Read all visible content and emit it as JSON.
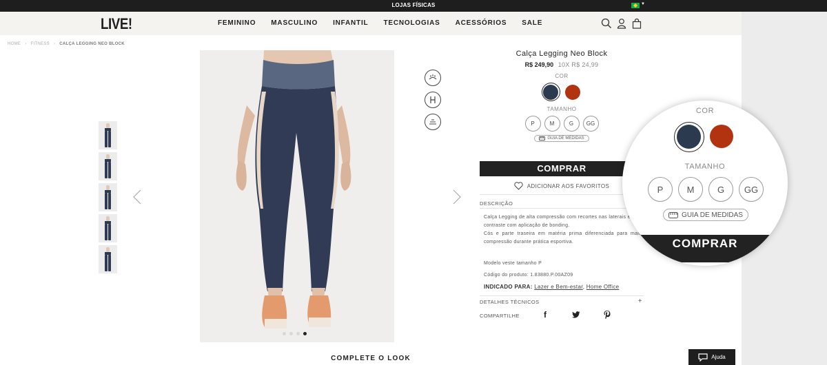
{
  "topbar": {
    "label": "LOJAS FÍSICAS"
  },
  "header": {
    "logo": "LIVE!",
    "nav": [
      "FEMININO",
      "MASCULINO",
      "INFANTIL",
      "TECNOLOGIAS",
      "ACESSÓRIOS",
      "SALE"
    ],
    "icons": [
      "search-icon",
      "user-icon",
      "bag-icon"
    ]
  },
  "breadcrumb": {
    "home": "HOME",
    "category": "FITNESS",
    "current": "CALÇA LEGGING NEO BLOCK"
  },
  "product": {
    "title": "Calça Legging Neo Block",
    "price": "R$ 249,90",
    "installments": "10X R$ 24,99",
    "color_label": "COR",
    "colors": [
      {
        "name": "navy",
        "hex": "#2b3a4f",
        "selected": true
      },
      {
        "name": "rust",
        "hex": "#b23310",
        "selected": false
      }
    ],
    "size_label": "TAMANHO",
    "sizes": [
      "P",
      "M",
      "G",
      "GG"
    ],
    "size_guide": "GUIA DE MEDIDAS",
    "buy_button": "COMPRAR",
    "favorite": "ADICIONAR AOS FAVORITOS",
    "description_header": "DESCRIÇÃO",
    "description_1": "Calça Legging de alta compressão com recortes nas laterais em cor contraste com aplicação de bonding.",
    "description_2": "Cós e parte traseira em matéria prima diferenciada para maior compressão durante prática esportiva.",
    "model": "Modelo veste tamanho P",
    "code": "Código do produto: 1.83880.P.00AZ09",
    "indicated_label": "INDICADO PARA:",
    "indicated_1": "Lazer e Bem-estar",
    "indicated_sep": ",",
    "indicated_2": "Home Office",
    "details": "DETALHES TÉCNICOS",
    "details_toggle": "+",
    "share": "COMPARTILHE",
    "social": {
      "facebook": "f",
      "twitter": "t",
      "pinterest": "p"
    }
  },
  "gallery": {
    "thumb_count": 5,
    "active_dot": 3,
    "dot_count": 4
  },
  "complete_look": "COMPLETE O LOOK",
  "help": "Ajuda",
  "colors": {
    "dark": "#1e1e1e",
    "header_bg": "#f4f3f0",
    "navy": "#2b3a4f",
    "rust": "#b23310"
  }
}
